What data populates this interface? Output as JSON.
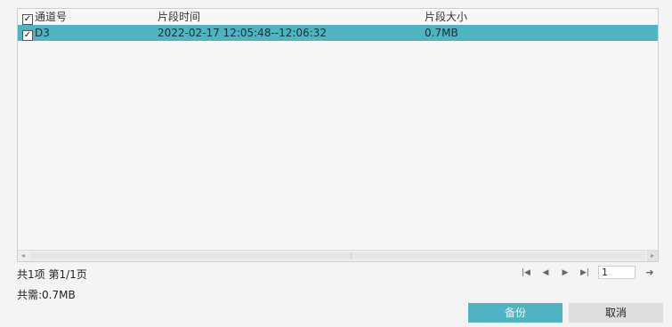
{
  "table": {
    "headers": {
      "channel": "通道号",
      "time": "片段时间",
      "size": "片段大小"
    },
    "rows": [
      {
        "channel": "D3",
        "time": "2022-02-17 12:05:48--12:06:32",
        "size": "0.7MB",
        "checked": true
      }
    ],
    "header_checked": true
  },
  "footer": {
    "summary": "共1项 第1/1页",
    "total_needed": "共需:0.7MB"
  },
  "pager": {
    "page_value": "1",
    "first_icon": "skip-first-icon",
    "prev_icon": "prev-icon",
    "next_icon": "next-icon",
    "last_icon": "skip-last-icon",
    "go_icon": "go-arrow-icon"
  },
  "buttons": {
    "backup": "备份",
    "cancel": "取消"
  },
  "colors": {
    "accent": "#4fb3c1",
    "cancel_bg": "#dedede"
  }
}
